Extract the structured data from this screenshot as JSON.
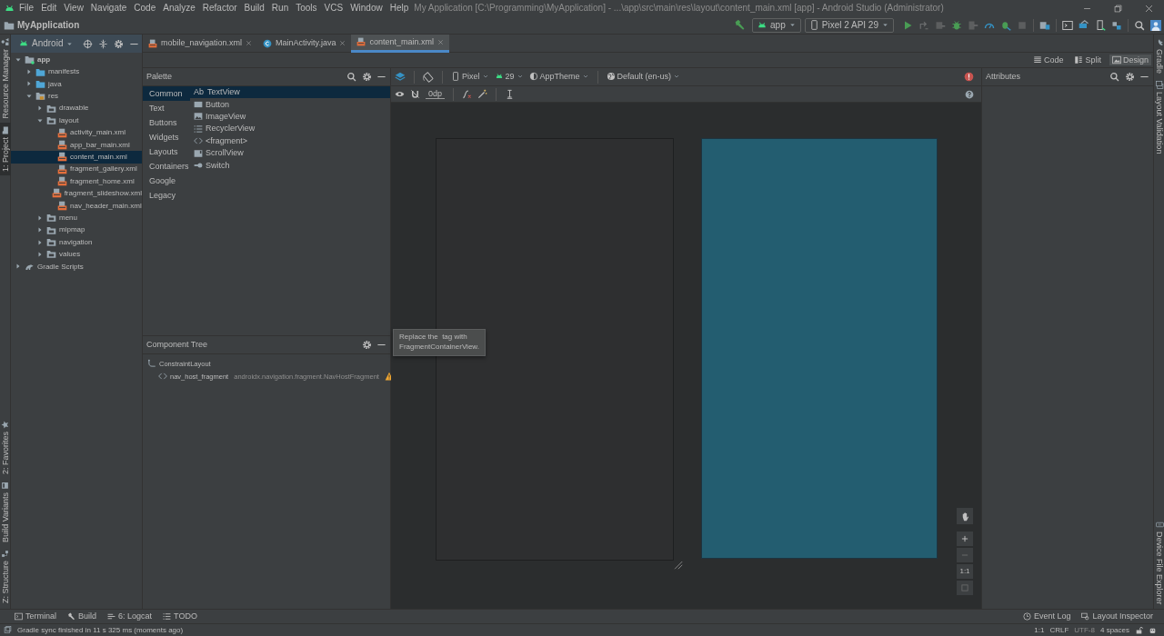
{
  "menu_bar": [
    "File",
    "Edit",
    "View",
    "Navigate",
    "Code",
    "Analyze",
    "Refactor",
    "Build",
    "Run",
    "Tools",
    "VCS",
    "Window",
    "Help"
  ],
  "window_title": "My Application [C:\\Programming\\MyApplication] - ...\\app\\src\\main\\res\\layout\\content_main.xml [app] - Android Studio (Administrator)",
  "breadcrumb": "MyApplication",
  "run_config": "app",
  "device": "Pixel 2 API 29",
  "left_tool_windows": {
    "top": [
      {
        "label": "Resource Manager",
        "kind": "resources",
        "selected": false
      },
      {
        "label": "1: Project",
        "kind": "project",
        "selected": true
      }
    ],
    "bottom": [
      {
        "label": "2: Favorites",
        "kind": "favorites",
        "selected": false
      },
      {
        "label": "Build Variants",
        "kind": "variants",
        "selected": false
      },
      {
        "label": "Z: Structure",
        "kind": "structure",
        "selected": false
      }
    ]
  },
  "right_tool_windows": {
    "top": [
      {
        "label": "Gradle",
        "kind": "gradle"
      },
      {
        "label": "Layout Validation",
        "kind": "validation"
      }
    ],
    "bottom": [
      {
        "label": "Device File Explorer",
        "kind": "files"
      }
    ]
  },
  "project_view": {
    "mode": "Android",
    "tree": [
      {
        "label": "app",
        "kind": "module",
        "expanded": true,
        "selected": false,
        "children": [
          {
            "label": "manifests",
            "kind": "source",
            "expanded": false,
            "selected": false
          },
          {
            "label": "java",
            "kind": "source",
            "expanded": false,
            "selected": false
          },
          {
            "label": "res",
            "kind": "res",
            "expanded": true,
            "selected": false,
            "children": [
              {
                "label": "drawable",
                "kind": "folder",
                "expanded": false,
                "selected": false
              },
              {
                "label": "layout",
                "kind": "folder",
                "expanded": true,
                "selected": false,
                "children": [
                  {
                    "label": "activity_main.xml",
                    "kind": "xml",
                    "selected": false
                  },
                  {
                    "label": "app_bar_main.xml",
                    "kind": "xml",
                    "selected": false
                  },
                  {
                    "label": "content_main.xml",
                    "kind": "xml",
                    "selected": true
                  },
                  {
                    "label": "fragment_gallery.xml",
                    "kind": "xml",
                    "selected": false
                  },
                  {
                    "label": "fragment_home.xml",
                    "kind": "xml",
                    "selected": false
                  },
                  {
                    "label": "fragment_slideshow.xml",
                    "kind": "xml",
                    "selected": false
                  },
                  {
                    "label": "nav_header_main.xml",
                    "kind": "xml",
                    "selected": false
                  }
                ]
              },
              {
                "label": "menu",
                "kind": "folder",
                "expanded": false,
                "selected": false
              },
              {
                "label": "mipmap",
                "kind": "folder",
                "expanded": false,
                "selected": false
              },
              {
                "label": "navigation",
                "kind": "folder",
                "expanded": false,
                "selected": false
              },
              {
                "label": "values",
                "kind": "folder",
                "expanded": false,
                "selected": false
              }
            ]
          }
        ]
      },
      {
        "label": "Gradle Scripts",
        "kind": "gradle",
        "expanded": false,
        "selected": false
      }
    ]
  },
  "editor_tabs": [
    {
      "label": "mobile_navigation.xml",
      "kind": "xml",
      "selected": false
    },
    {
      "label": "MainActivity.java",
      "kind": "java",
      "selected": false
    },
    {
      "label": "content_main.xml",
      "kind": "xml",
      "selected": true
    }
  ],
  "view_modes": [
    {
      "label": "Code",
      "kind": "code",
      "selected": false
    },
    {
      "label": "Split",
      "kind": "split",
      "selected": false
    },
    {
      "label": "Design",
      "kind": "design",
      "selected": true
    }
  ],
  "palette": {
    "title": "Palette",
    "categories": [
      {
        "label": "Common",
        "selected": true
      },
      {
        "label": "Text",
        "selected": false
      },
      {
        "label": "Buttons",
        "selected": false
      },
      {
        "label": "Widgets",
        "selected": false
      },
      {
        "label": "Layouts",
        "selected": false
      },
      {
        "label": "Containers",
        "selected": false
      },
      {
        "label": "Google",
        "selected": false
      },
      {
        "label": "Legacy",
        "selected": false
      }
    ],
    "items": [
      {
        "label": "TextView",
        "kind": "text",
        "glyph": "Ab",
        "selected": true
      },
      {
        "label": "Button",
        "kind": "button",
        "selected": false
      },
      {
        "label": "ImageView",
        "kind": "image",
        "selected": false
      },
      {
        "label": "RecyclerView",
        "kind": "list",
        "selected": false
      },
      {
        "label": "<fragment>",
        "kind": "code",
        "selected": false
      },
      {
        "label": "ScrollView",
        "kind": "scroll",
        "selected": false
      },
      {
        "label": "Switch",
        "kind": "switch",
        "selected": false
      }
    ]
  },
  "design_toolbar": {
    "device": "Pixel",
    "api": "29",
    "theme": "AppTheme",
    "locale": "Default (en-us)",
    "margin": "0dp"
  },
  "component_tree": {
    "title": "Component Tree",
    "nodes": [
      {
        "label": "ConstraintLayout",
        "kind": "constraint",
        "children": [
          {
            "label": "nav_host_fragment",
            "detail": "androidx.navigation.fragment.NavHostFragment",
            "kind": "fragment",
            "warning": true
          }
        ]
      }
    ]
  },
  "tooltip": [
    "Replace the  tag with",
    "FragmentContainerView."
  ],
  "attributes": {
    "title": "Attributes"
  },
  "zoom_label": "1:1",
  "bottom_tools": {
    "left": [
      {
        "label": "Terminal",
        "kind": "terminal"
      },
      {
        "label": "Build",
        "kind": "build"
      },
      {
        "label": "6: Logcat",
        "kind": "logcat"
      },
      {
        "label": "TODO",
        "kind": "todo"
      }
    ],
    "right": [
      {
        "label": "Event Log",
        "kind": "eventlog"
      },
      {
        "label": "Layout Inspector",
        "kind": "inspector"
      }
    ]
  },
  "status_bar": {
    "message": "Gradle sync finished in 11 s 325 ms (moments ago)",
    "position": "1:1",
    "line_separator": "CRLF",
    "encoding": "UTF-8",
    "indent": "4 spaces"
  }
}
